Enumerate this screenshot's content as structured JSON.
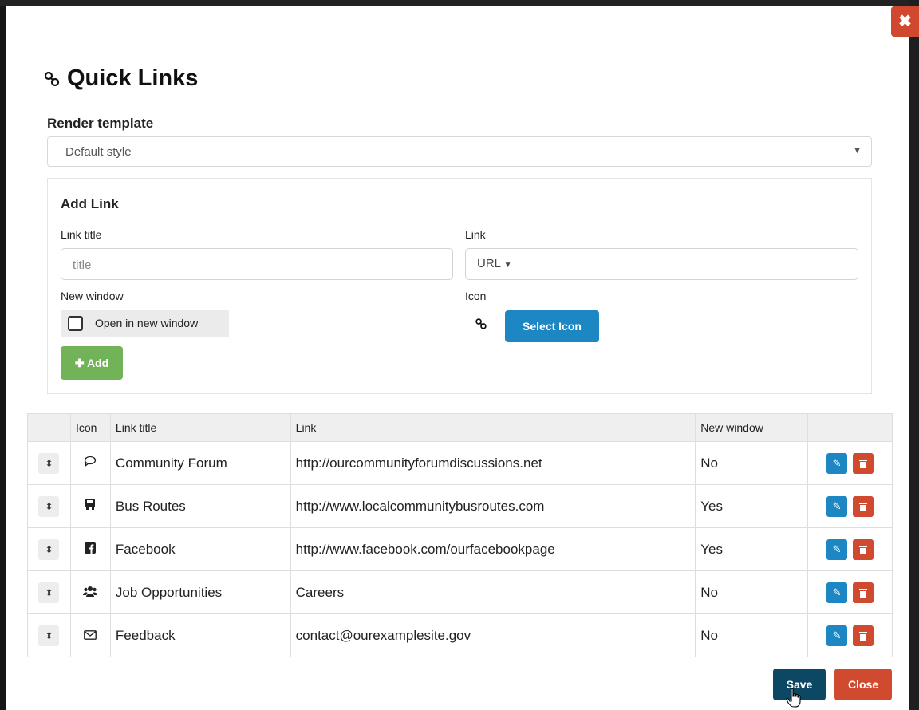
{
  "modal": {
    "title": "Quick Links",
    "render_template_label": "Render template",
    "render_template_value": "Default style"
  },
  "add_link": {
    "heading": "Add Link",
    "link_title_label": "Link title",
    "link_title_placeholder": "title",
    "link_label": "Link",
    "link_type_value": "URL",
    "new_window_label": "New window",
    "open_new_window_label": "Open in new window",
    "icon_label": "Icon",
    "select_icon_button": "Select Icon",
    "add_button": "Add"
  },
  "table": {
    "headers": [
      "Icon",
      "Link title",
      "Link",
      "New window"
    ],
    "rows": [
      {
        "icon": "comment-icon",
        "title": "Community Forum",
        "link": "http://ourcommunityforumdiscussions.net",
        "new_window": "No"
      },
      {
        "icon": "bus-icon",
        "title": "Bus Routes",
        "link": "http://www.localcommunitybusroutes.com",
        "new_window": "Yes"
      },
      {
        "icon": "facebook-icon",
        "title": "Facebook",
        "link": "http://www.facebook.com/ourfacebookpage",
        "new_window": "Yes"
      },
      {
        "icon": "users-icon",
        "title": "Job Opportunities",
        "link": "Careers",
        "new_window": "No"
      },
      {
        "icon": "envelope-icon",
        "title": "Feedback",
        "link": "contact@ourexamplesite.gov",
        "new_window": "No"
      }
    ]
  },
  "footer": {
    "save_button": "Save",
    "close_button": "Close"
  },
  "colors": {
    "primary": "#1d87c4",
    "danger": "#cf4a2e",
    "success": "#72b35a",
    "save": "#0c4763"
  }
}
